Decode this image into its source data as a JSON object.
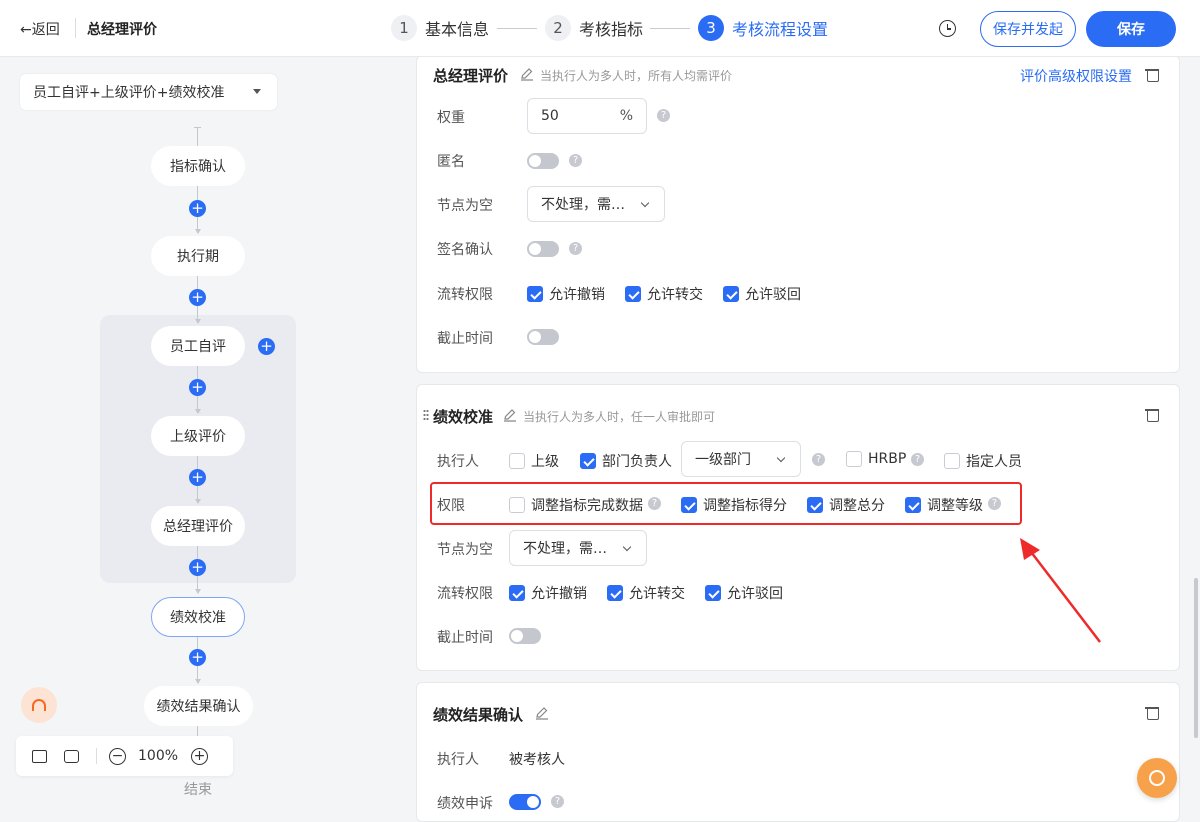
{
  "header": {
    "back_label": "←返回",
    "page_title": "总经理评价",
    "steps": [
      {
        "num": "1",
        "label": "基本信息"
      },
      {
        "num": "2",
        "label": "考核指标"
      },
      {
        "num": "3",
        "label": "考核流程设置"
      }
    ],
    "active_step": 3,
    "save_and_launch_label": "保存并发起",
    "save_label": "保存",
    "accent_color": "#2a6cf4"
  },
  "flow": {
    "template_select": "员工自评+上级评价+绩效校准",
    "nodes": [
      "指标确认",
      "执行期",
      "员工自评",
      "上级评价",
      "总经理评价",
      "绩效校准",
      "绩效结果确认"
    ],
    "selected_node": "绩效校准",
    "end_label": "结束",
    "plus_symbol": "+",
    "zoom": "100%",
    "zoom_out_symbol": "−",
    "zoom_in_symbol": "+"
  },
  "section1": {
    "title": "总经理评价",
    "hint": "当执行人为多人时，所有人均需评价",
    "advanced_link": "评价高级权限设置",
    "weight_label": "权重",
    "weight_value": "50",
    "weight_suffix": "%",
    "anonymous_label": "匿名",
    "anonymous_on": false,
    "empty_node_label": "节点为空",
    "empty_node_value": "不处理，需…",
    "signature_label": "签名确认",
    "signature_on": false,
    "flow_perm_label": "流转权限",
    "flow_perms": [
      {
        "label": "允许撤销",
        "checked": true
      },
      {
        "label": "允许转交",
        "checked": true
      },
      {
        "label": "允许驳回",
        "checked": true
      }
    ],
    "deadline_label": "截止时间",
    "deadline_on": false
  },
  "section2": {
    "title": "绩效校准",
    "hint": "当执行人为多人时，任一人审批即可",
    "executor_label": "执行人",
    "executors": [
      {
        "label": "上级",
        "checked": false
      },
      {
        "label": "部门负责人",
        "checked": true
      }
    ],
    "dept_select": "一级部门",
    "hrbp": {
      "label": "HRBP",
      "checked": false
    },
    "designated": {
      "label": "指定人员",
      "checked": false
    },
    "perm_label": "权限",
    "perms": [
      {
        "label": "调整指标完成数据",
        "checked": false
      },
      {
        "label": "调整指标得分",
        "checked": true
      },
      {
        "label": "调整总分",
        "checked": true
      },
      {
        "label": "调整等级",
        "checked": true
      }
    ],
    "empty_node_label": "节点为空",
    "empty_node_value": "不处理，需…",
    "flow_perm_label": "流转权限",
    "flow_perms": [
      {
        "label": "允许撤销",
        "checked": true
      },
      {
        "label": "允许转交",
        "checked": true
      },
      {
        "label": "允许驳回",
        "checked": true
      }
    ],
    "deadline_label": "截止时间",
    "deadline_on": false
  },
  "section3": {
    "title": "绩效结果确认",
    "executor_label": "执行人",
    "executor_value": "被考核人",
    "appeal_label": "绩效申诉",
    "appeal_on": true
  },
  "help_symbol": "?",
  "annotation_color": "#ee2a2a"
}
